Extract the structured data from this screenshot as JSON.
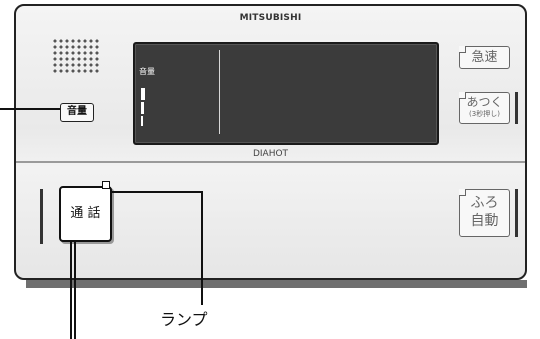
{
  "panel": {
    "brand": "MITSUBISHI",
    "model_label": "DIAHOT"
  },
  "display": {
    "volume_label": "音量"
  },
  "buttons": {
    "volume": "音量",
    "kyusoku": "急速",
    "atsuku_main": "あつく",
    "atsuku_sub": "(3秒押し)",
    "furo_line1": "ふろ",
    "furo_line2": "自動",
    "call": "通 話"
  },
  "callouts": {
    "lamp": "ランプ"
  }
}
